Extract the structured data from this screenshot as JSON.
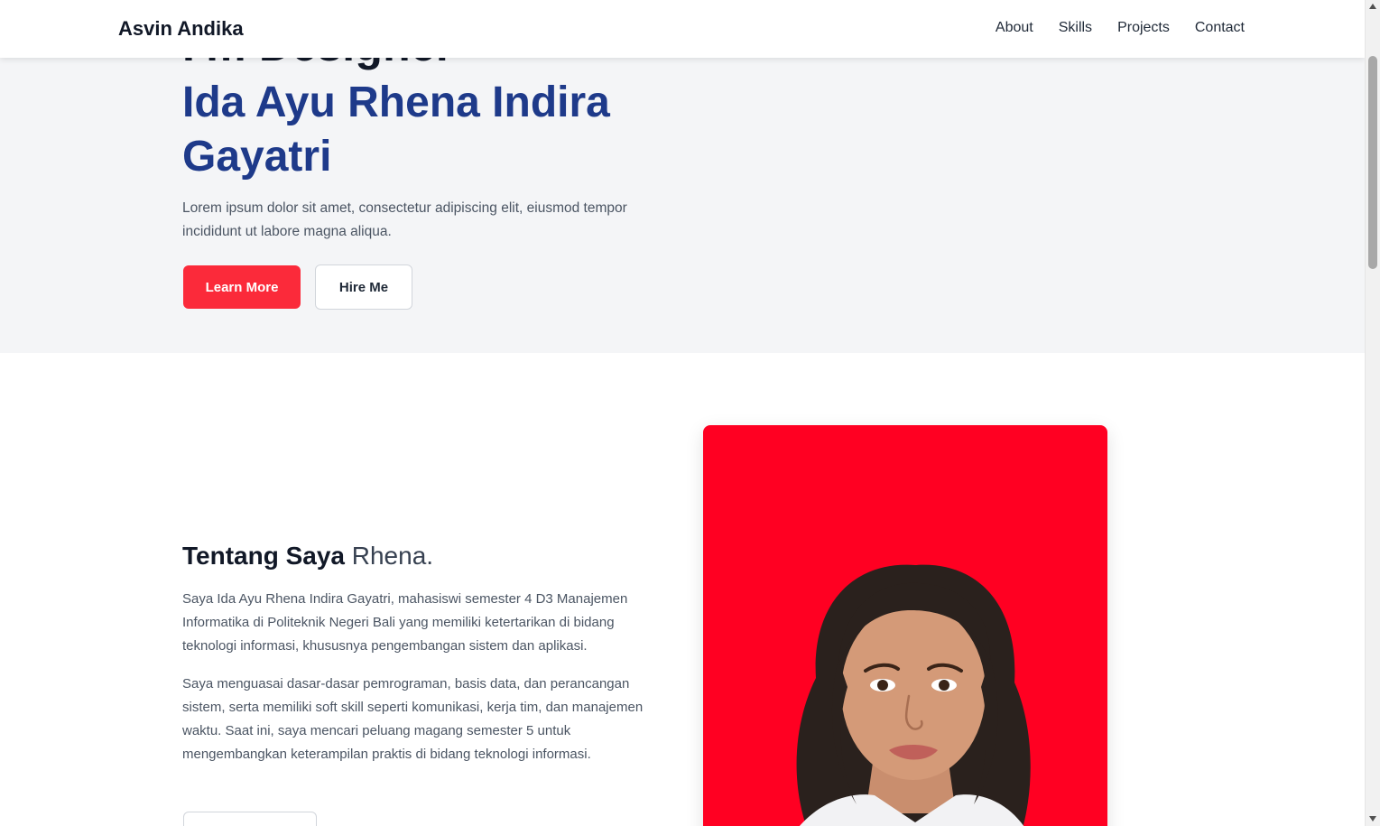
{
  "navbar": {
    "brand": "Asvin Andika",
    "links": [
      "About",
      "Skills",
      "Projects",
      "Contact"
    ]
  },
  "hero": {
    "title_partial": "I'm Designer",
    "name": "Ida Ayu Rhena Indira Gayatri",
    "description": "Lorem ipsum dolor sit amet, consectetur adipiscing elit, eiusmod tempor incididunt ut labore magna aliqua.",
    "primary_button": "Learn More",
    "secondary_button": "Hire Me"
  },
  "about": {
    "title": "Tentang Saya",
    "title_accent": "Rhena.",
    "paragraph1": "Saya Ida Ayu Rhena Indira Gayatri, mahasiswi semester 4 D3 Manajemen Informatika di Politeknik Negeri Bali yang memiliki ketertarikan di bidang teknologi informasi, khususnya pengembangan sistem dan aplikasi.",
    "paragraph2": "Saya menguasai dasar-dasar pemrograman, basis data, dan perancangan sistem, serta memiliki soft skill seperti komunikasi, kerja tim, dan manajemen waktu. Saat ini, saya mencari peluang magang semester 5 untuk mengembangkan keterampilan praktis di bidang teknologi informasi."
  },
  "colors": {
    "accent_red": "#fb2a3a",
    "name_blue": "#1e3a8a",
    "photo_background": "#ff0022",
    "hero_background": "#f4f5f7"
  }
}
